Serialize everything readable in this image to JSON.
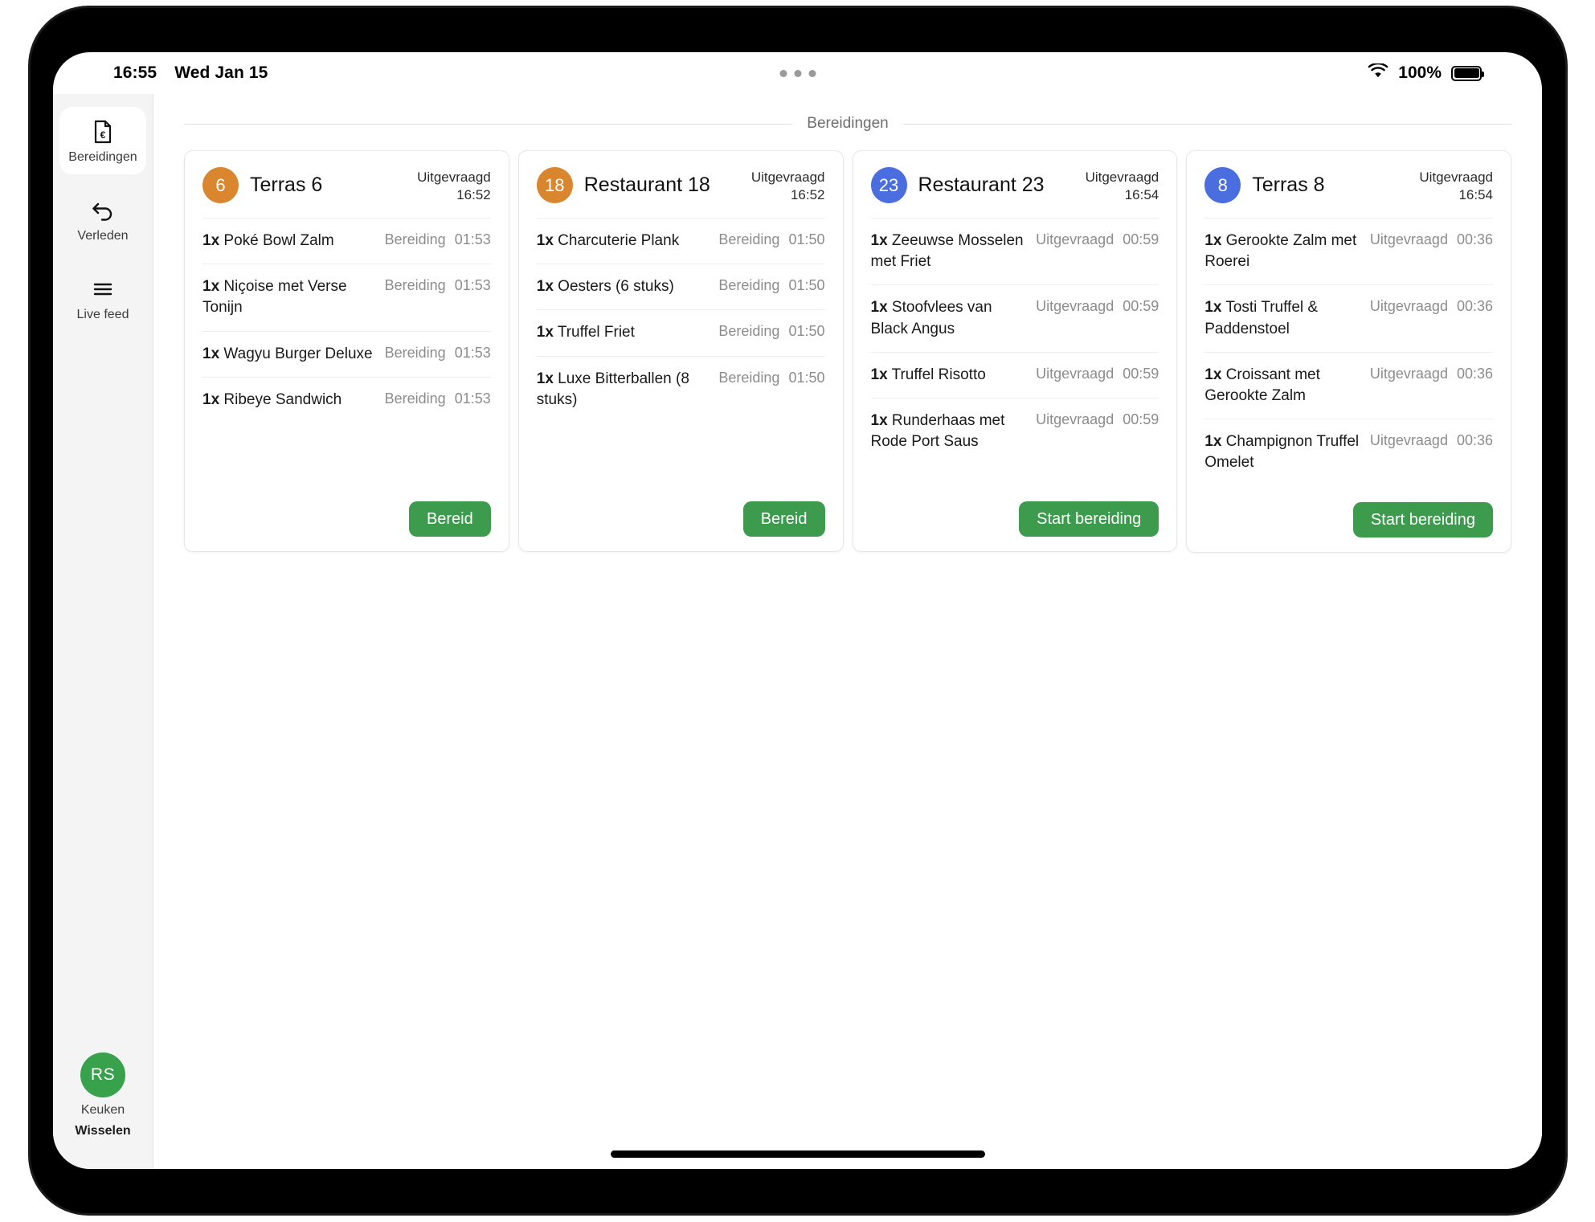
{
  "status_bar": {
    "time": "16:55",
    "date": "Wed Jan 15",
    "battery_percent": "100%"
  },
  "sidebar": {
    "items": [
      {
        "label": "Bereidingen",
        "icon": "document-euro-icon",
        "active": true
      },
      {
        "label": "Verleden",
        "icon": "undo-arrow-icon",
        "active": false
      },
      {
        "label": "Live feed",
        "icon": "hamburger-lines-icon",
        "active": false
      }
    ],
    "user": {
      "initials": "RS",
      "role": "Keuken",
      "action": "Wisselen"
    }
  },
  "main": {
    "section_title": "Bereidingen",
    "cards": [
      {
        "badge": "6",
        "badge_color": "#d9862f",
        "badge_style": "orange",
        "title": "Terras 6",
        "requested_label": "Uitgevraagd",
        "requested_time": "16:52",
        "items": [
          {
            "qty": "1x",
            "name": "Poké Bowl Zalm",
            "status": "Bereiding",
            "timer": "01:53"
          },
          {
            "qty": "1x",
            "name": "Niçoise met Verse Tonijn",
            "status": "Bereiding",
            "timer": "01:53"
          },
          {
            "qty": "1x",
            "name": "Wagyu Burger Deluxe",
            "status": "Bereiding",
            "timer": "01:53"
          },
          {
            "qty": "1x",
            "name": "Ribeye Sandwich",
            "status": "Bereiding",
            "timer": "01:53"
          }
        ],
        "button": "Bereid"
      },
      {
        "badge": "18",
        "badge_color": "#d9862f",
        "badge_style": "orange",
        "title": "Restaurant 18",
        "requested_label": "Uitgevraagd",
        "requested_time": "16:52",
        "items": [
          {
            "qty": "1x",
            "name": "Charcuterie Plank",
            "status": "Bereiding",
            "timer": "01:50"
          },
          {
            "qty": "1x",
            "name": "Oesters (6 stuks)",
            "status": "Bereiding",
            "timer": "01:50"
          },
          {
            "qty": "1x",
            "name": "Truffel Friet",
            "status": "Bereiding",
            "timer": "01:50"
          },
          {
            "qty": "1x",
            "name": "Luxe Bitterballen (8 stuks)",
            "status": "Bereiding",
            "timer": "01:50"
          }
        ],
        "button": "Bereid"
      },
      {
        "badge": "23",
        "badge_color": "#4a6ee0",
        "badge_style": "blue",
        "title": "Restaurant 23",
        "requested_label": "Uitgevraagd",
        "requested_time": "16:54",
        "items": [
          {
            "qty": "1x",
            "name": "Zeeuwse Mosselen met Friet",
            "status": "Uitgevraagd",
            "timer": "00:59"
          },
          {
            "qty": "1x",
            "name": "Stoofvlees van Black Angus",
            "status": "Uitgevraagd",
            "timer": "00:59"
          },
          {
            "qty": "1x",
            "name": "Truffel Risotto",
            "status": "Uitgevraagd",
            "timer": "00:59"
          },
          {
            "qty": "1x",
            "name": "Runderhaas met Rode Port Saus",
            "status": "Uitgevraagd",
            "timer": "00:59"
          }
        ],
        "button": "Start bereiding"
      },
      {
        "badge": "8",
        "badge_color": "#4a6ee0",
        "badge_style": "blue",
        "title": "Terras 8",
        "requested_label": "Uitgevraagd",
        "requested_time": "16:54",
        "items": [
          {
            "qty": "1x",
            "name": "Gerookte Zalm met Roerei",
            "status": "Uitgevraagd",
            "timer": "00:36"
          },
          {
            "qty": "1x",
            "name": "Tosti Truffel & Paddenstoel",
            "status": "Uitgevraagd",
            "timer": "00:36"
          },
          {
            "qty": "1x",
            "name": "Croissant met Gerookte Zalm",
            "status": "Uitgevraagd",
            "timer": "00:36"
          },
          {
            "qty": "1x",
            "name": "Champignon Truffel Omelet",
            "status": "Uitgevraagd",
            "timer": "00:36"
          }
        ],
        "button": "Start bereiding"
      }
    ]
  },
  "theme": {
    "accent_green": "#3d9b4e",
    "badge_orange": "#d9862f",
    "badge_blue": "#4a6ee0",
    "sidebar_bg": "#f4f4f4"
  }
}
